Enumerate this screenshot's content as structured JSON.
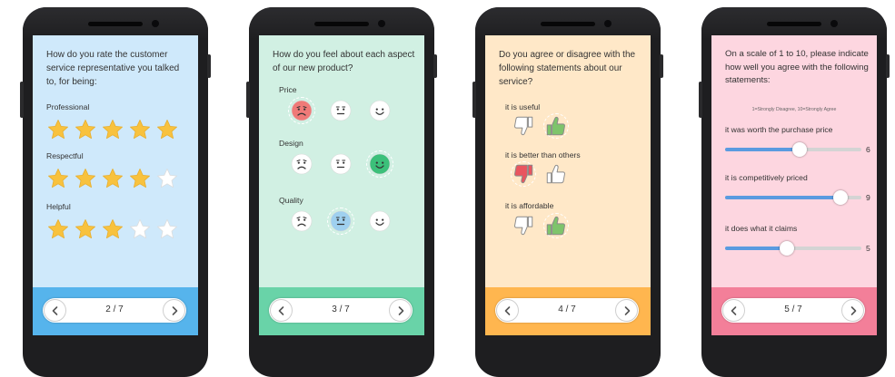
{
  "screens": [
    {
      "content_bg": "#cfe9fb",
      "footer_bg": "#56b4ec",
      "question": "How do you rate the customer service representative you talked to, for being:",
      "items": [
        {
          "label": "Professional",
          "rating": 5,
          "max": 5
        },
        {
          "label": "Respectful",
          "rating": 4,
          "max": 5
        },
        {
          "label": "Helpful",
          "rating": 3,
          "max": 5
        }
      ],
      "page": "2 / 7"
    },
    {
      "content_bg": "#d1f0e3",
      "footer_bg": "#69d3a8",
      "question": "How do you feel about each aspect of our new product?",
      "items": [
        {
          "label": "Price",
          "selected": "sad"
        },
        {
          "label": "Design",
          "selected": "happy"
        },
        {
          "label": "Quality",
          "selected": "neutral"
        }
      ],
      "page": "3 / 7"
    },
    {
      "content_bg": "#ffe8c8",
      "footer_bg": "#ffb64f",
      "question": "Do you agree or disagree with the following statements about our service?",
      "items": [
        {
          "label": "it is useful",
          "selected": "agree"
        },
        {
          "label": "it is better than others",
          "selected": "disagree"
        },
        {
          "label": "it is affordable",
          "selected": "agree"
        }
      ],
      "page": "4 / 7"
    },
    {
      "content_bg": "#fdd6e0",
      "footer_bg": "#f37f99",
      "question": "On a scale of 1 to 10, please indicate how well you agree with the following statements:",
      "scale_note": "1=Strongly Disagree, 10=Strongly Agree",
      "items": [
        {
          "label": "it was worth the purchase price",
          "value": 6
        },
        {
          "label": "it is competitively priced",
          "value": 9
        },
        {
          "label": "it does what it claims",
          "value": 5
        }
      ],
      "page": "5 / 7"
    }
  ],
  "icons": {
    "star": "star-icon",
    "sad": "sad-face-icon",
    "neutral": "neutral-face-icon",
    "happy": "happy-face-icon",
    "agree": "thumbs-up-icon",
    "disagree": "thumbs-down-icon",
    "prev": "chevron-left-icon",
    "next": "chevron-right-icon"
  },
  "colors": {
    "star_filled": "#f8c23e",
    "star_empty": "#ffffff",
    "sad_selected": "#ef7a78",
    "neutral_selected": "#9fd0ef",
    "happy_selected": "#3cc07a",
    "thumb_up_selected": "#7ec46b",
    "thumb_down_selected": "#e9555f",
    "slider_fill": "#5a9be0"
  }
}
